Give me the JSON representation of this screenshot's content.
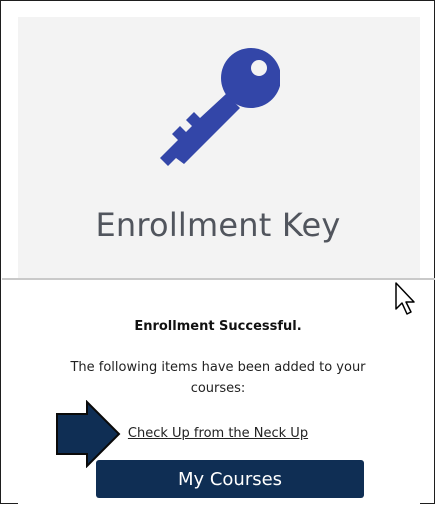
{
  "header": {
    "title": "Enrollment Key",
    "icon": "key-icon",
    "icon_color": "#3346a8"
  },
  "result": {
    "status": "Enrollment Successful.",
    "message": "The following items have been added to your courses:",
    "items": [
      {
        "label": "Check Up from the Neck Up"
      }
    ]
  },
  "actions": {
    "my_courses_label": "My Courses",
    "button_color": "#0f2e54"
  },
  "overlay": {
    "pointer": "mouse-pointer-icon",
    "callout": "arrow-callout-icon"
  }
}
